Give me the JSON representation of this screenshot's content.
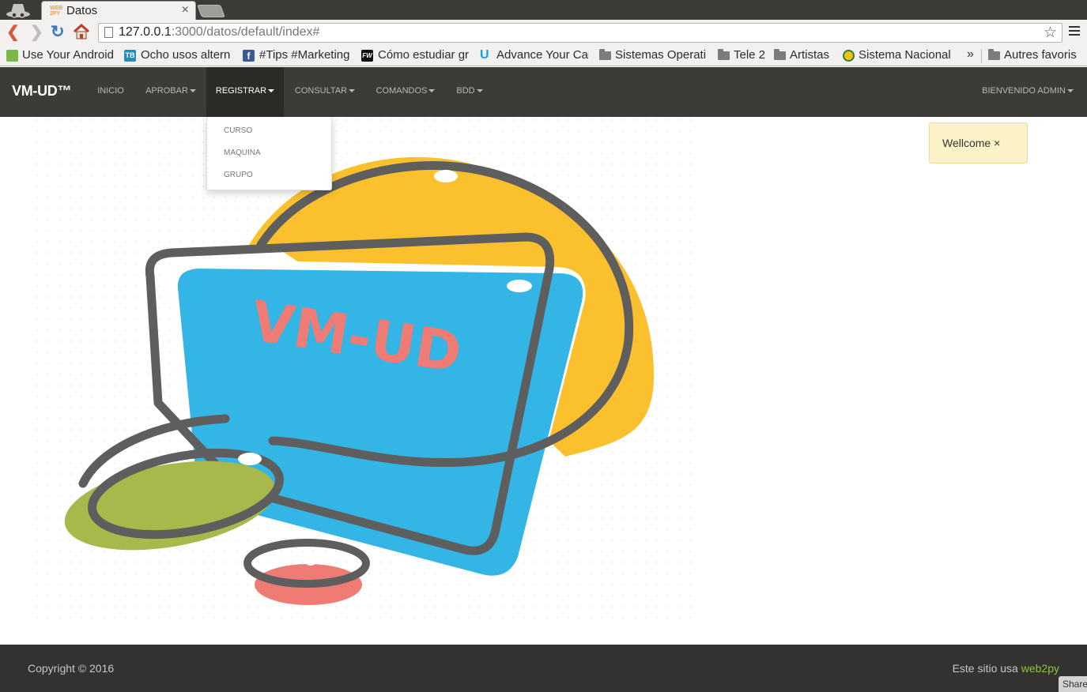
{
  "browser": {
    "tab_title": "Datos",
    "tab_favicon": "web2py-favicon",
    "url_host": "127.0.0.1",
    "url_rest": ":3000/datos/default/index#",
    "bookmarks": [
      {
        "label": "Use Your Android",
        "icon": "android-app-icon",
        "color": "#7ab648"
      },
      {
        "label": "Ocho usos altern",
        "icon": "tb-icon",
        "color": "#1b8fc2"
      },
      {
        "label": "#Tips #Marketing",
        "icon": "facebook-icon",
        "color": "#3b5998"
      },
      {
        "label": "Cómo estudiar gr",
        "icon": "fw-icon",
        "color": "#111111"
      },
      {
        "label": "Advance Your Car",
        "icon": "udacity-icon",
        "color": "#16a1e3"
      },
      {
        "label": "Sistemas Operati",
        "icon": "folder-icon"
      },
      {
        "label": "Tele 2",
        "icon": "folder-icon"
      },
      {
        "label": "Artistas",
        "icon": "folder-icon"
      },
      {
        "label": "Sistema Nacional",
        "icon": "seal-icon",
        "color": "#2f7d3a"
      }
    ],
    "overflow_label": "»",
    "other_bookmarks": "Autres favoris"
  },
  "navbar": {
    "brand": "VM-UD™",
    "items": [
      {
        "label": "INICIO",
        "dropdown": false
      },
      {
        "label": "APROBAR",
        "dropdown": true
      },
      {
        "label": "REGISTRAR",
        "dropdown": true,
        "active": true
      },
      {
        "label": "CONSULTAR",
        "dropdown": true
      },
      {
        "label": "COMANDOS",
        "dropdown": true
      },
      {
        "label": "BDD",
        "dropdown": true
      }
    ],
    "user_menu": "BIENVENIDO ADMIN"
  },
  "dropdown": {
    "items": [
      "CURSO",
      "MAQUINA",
      "GRUPO"
    ]
  },
  "flash": {
    "text": "Wellcome ×"
  },
  "hero": {
    "logo_text": "VM-UD",
    "colors": {
      "yellow": "#fbc02d",
      "blue": "#33b5e5",
      "green": "#a8b84b",
      "red": "#ef7b75",
      "outline": "#5e5e5e"
    }
  },
  "footer": {
    "copyright": "Copyright © 2016",
    "powered_prefix": "Este sitio usa ",
    "powered_link": "web2py"
  },
  "share_button": "Share"
}
